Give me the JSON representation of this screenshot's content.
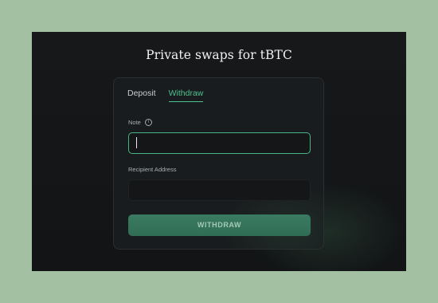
{
  "header": {
    "title": "Private swaps for tBTC"
  },
  "tabs": [
    {
      "label": "Deposit",
      "active": false
    },
    {
      "label": "Withdraw",
      "active": true
    }
  ],
  "form": {
    "note_label": "Note",
    "note_value": "",
    "recipient_label": "Recipient Address",
    "recipient_value": "",
    "submit_label": "WITHDRAW"
  },
  "icons": {
    "note_info": "info-icon"
  },
  "colors": {
    "accent": "#4fc08f",
    "button": "#3a7b61",
    "background": "#a3c1a2"
  }
}
